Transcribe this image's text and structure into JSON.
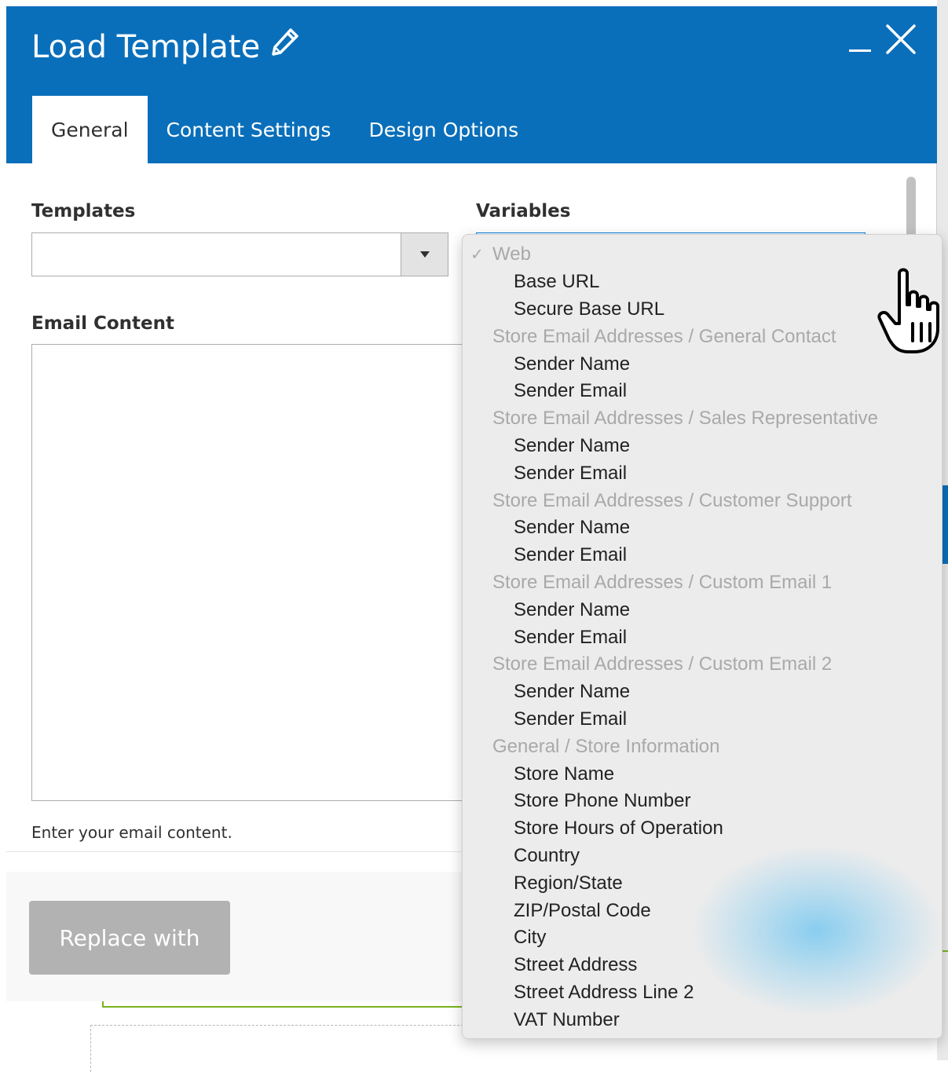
{
  "modal": {
    "title": "Load Template",
    "title_icon": "pencil-icon",
    "minimize_icon": "minimize-icon",
    "close_icon": "close-icon"
  },
  "tabs": [
    {
      "label": "General",
      "active": true
    },
    {
      "label": "Content Settings",
      "active": false
    },
    {
      "label": "Design Options",
      "active": false
    }
  ],
  "form": {
    "templates_label": "Templates",
    "templates_value": "",
    "variables_label": "Variables",
    "email_content_label": "Email Content",
    "email_content_value": "",
    "help_text": "Enter your email content."
  },
  "footer": {
    "replace_button_label": "Replace with"
  },
  "variables_dropdown": {
    "groups": [
      {
        "label": "Web",
        "checked": true,
        "options": [
          "Base URL",
          "Secure Base URL"
        ]
      },
      {
        "label": "Store Email Addresses / General Contact",
        "options": [
          "Sender Name",
          "Sender Email"
        ]
      },
      {
        "label": "Store Email Addresses / Sales Representative",
        "options": [
          "Sender Name",
          "Sender Email"
        ]
      },
      {
        "label": "Store Email Addresses / Customer Support",
        "options": [
          "Sender Name",
          "Sender Email"
        ]
      },
      {
        "label": "Store Email Addresses / Custom Email 1",
        "options": [
          "Sender Name",
          "Sender Email"
        ]
      },
      {
        "label": "Store Email Addresses / Custom Email 2",
        "options": [
          "Sender Name",
          "Sender Email"
        ]
      },
      {
        "label": "General / Store Information",
        "options": [
          "Store Name",
          "Store Phone Number",
          "Store Hours of Operation",
          "Country",
          "Region/State",
          "ZIP/Postal Code",
          "City",
          "Street Address",
          "Street Address Line 2",
          "VAT Number"
        ]
      }
    ]
  },
  "colors": {
    "header_blue": "#0a6fba",
    "button_gray": "#b2b2b2",
    "group_label_gray": "#a9a9a9"
  }
}
